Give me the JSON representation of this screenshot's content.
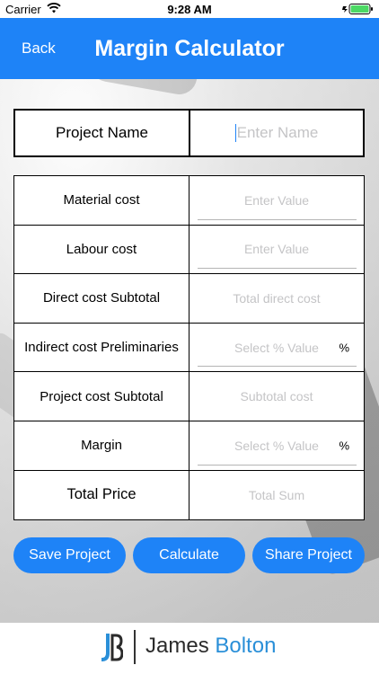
{
  "status_bar": {
    "carrier": "Carrier",
    "time": "9:28 AM"
  },
  "nav": {
    "back_label": "Back",
    "title": "Margin Calculator"
  },
  "project": {
    "label": "Project Name",
    "placeholder": "Enter Name"
  },
  "rows": [
    {
      "label": "Material cost",
      "placeholder": "Enter Value"
    },
    {
      "label": "Labour cost",
      "placeholder": "Enter Value"
    },
    {
      "label": "Direct cost Subtotal",
      "placeholder": "Total direct cost"
    },
    {
      "label": "Indirect cost Preliminaries",
      "placeholder": "Select % Value",
      "suffix": "%"
    },
    {
      "label": "Project cost Subtotal",
      "placeholder": "Subtotal cost"
    },
    {
      "label": "Margin",
      "placeholder": "Select % Value",
      "suffix": "%"
    },
    {
      "label": "Total Price",
      "placeholder": "Total Sum"
    }
  ],
  "buttons": {
    "save": "Save Project",
    "calculate": "Calculate",
    "share": "Share Project"
  },
  "footer": {
    "brand_first": "James",
    "brand_second": "Bolton"
  },
  "colors": {
    "accent": "#1e83f7",
    "brand_blue": "#2a8fd8"
  }
}
